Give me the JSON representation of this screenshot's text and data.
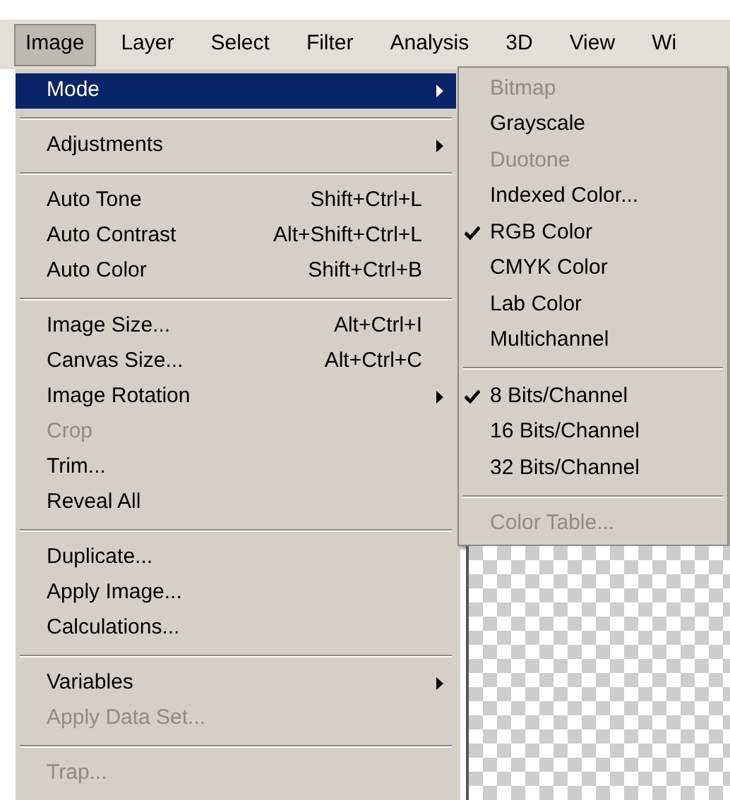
{
  "menu_bar": [
    {
      "label": "Image",
      "selected": true
    },
    {
      "label": "Layer",
      "selected": false
    },
    {
      "label": "Select",
      "selected": false
    },
    {
      "label": "Filter",
      "selected": false
    },
    {
      "label": "Analysis",
      "selected": false
    },
    {
      "label": "3D",
      "selected": false
    },
    {
      "label": "View",
      "selected": false
    },
    {
      "label": "Wi",
      "selected": false
    }
  ],
  "image_menu": [
    {
      "kind": "item",
      "label": "Mode",
      "submenu": true,
      "disabled": false,
      "selected": true
    },
    {
      "kind": "separator"
    },
    {
      "kind": "item",
      "label": "Adjustments",
      "submenu": true,
      "disabled": false,
      "selected": false
    },
    {
      "kind": "separator"
    },
    {
      "kind": "item",
      "label": "Auto Tone",
      "shortcut": "Shift+Ctrl+L",
      "submenu": false,
      "disabled": false,
      "selected": false
    },
    {
      "kind": "item",
      "label": "Auto Contrast",
      "shortcut": "Alt+Shift+Ctrl+L",
      "submenu": false,
      "disabled": false,
      "selected": false
    },
    {
      "kind": "item",
      "label": "Auto Color",
      "shortcut": "Shift+Ctrl+B",
      "submenu": false,
      "disabled": false,
      "selected": false
    },
    {
      "kind": "separator"
    },
    {
      "kind": "item",
      "label": "Image Size...",
      "shortcut": "Alt+Ctrl+I",
      "submenu": false,
      "disabled": false,
      "selected": false
    },
    {
      "kind": "item",
      "label": "Canvas Size...",
      "shortcut": "Alt+Ctrl+C",
      "submenu": false,
      "disabled": false,
      "selected": false
    },
    {
      "kind": "item",
      "label": "Image Rotation",
      "submenu": true,
      "disabled": false,
      "selected": false
    },
    {
      "kind": "item",
      "label": "Crop",
      "submenu": false,
      "disabled": true,
      "selected": false
    },
    {
      "kind": "item",
      "label": "Trim...",
      "submenu": false,
      "disabled": false,
      "selected": false
    },
    {
      "kind": "item",
      "label": "Reveal All",
      "submenu": false,
      "disabled": false,
      "selected": false
    },
    {
      "kind": "separator"
    },
    {
      "kind": "item",
      "label": "Duplicate...",
      "submenu": false,
      "disabled": false,
      "selected": false
    },
    {
      "kind": "item",
      "label": "Apply Image...",
      "submenu": false,
      "disabled": false,
      "selected": false
    },
    {
      "kind": "item",
      "label": "Calculations...",
      "submenu": false,
      "disabled": false,
      "selected": false
    },
    {
      "kind": "separator"
    },
    {
      "kind": "item",
      "label": "Variables",
      "submenu": true,
      "disabled": false,
      "selected": false
    },
    {
      "kind": "item",
      "label": "Apply Data Set...",
      "submenu": false,
      "disabled": true,
      "selected": false
    },
    {
      "kind": "separator"
    },
    {
      "kind": "item",
      "label": "Trap...",
      "submenu": false,
      "disabled": true,
      "selected": false
    }
  ],
  "mode_submenu": [
    {
      "kind": "item",
      "label": "Bitmap",
      "disabled": true,
      "checked": false
    },
    {
      "kind": "item",
      "label": "Grayscale",
      "disabled": false,
      "checked": false
    },
    {
      "kind": "item",
      "label": "Duotone",
      "disabled": true,
      "checked": false
    },
    {
      "kind": "item",
      "label": "Indexed Color...",
      "disabled": false,
      "checked": false
    },
    {
      "kind": "item",
      "label": "RGB Color",
      "disabled": false,
      "checked": true
    },
    {
      "kind": "item",
      "label": "CMYK Color",
      "disabled": false,
      "checked": false
    },
    {
      "kind": "item",
      "label": "Lab Color",
      "disabled": false,
      "checked": false
    },
    {
      "kind": "item",
      "label": "Multichannel",
      "disabled": false,
      "checked": false
    },
    {
      "kind": "separator"
    },
    {
      "kind": "item",
      "label": "8 Bits/Channel",
      "disabled": false,
      "checked": true
    },
    {
      "kind": "item",
      "label": "16 Bits/Channel",
      "disabled": false,
      "checked": false
    },
    {
      "kind": "item",
      "label": "32 Bits/Channel",
      "disabled": false,
      "checked": false
    },
    {
      "kind": "separator"
    },
    {
      "kind": "item",
      "label": "Color Table...",
      "disabled": true,
      "checked": false
    }
  ]
}
